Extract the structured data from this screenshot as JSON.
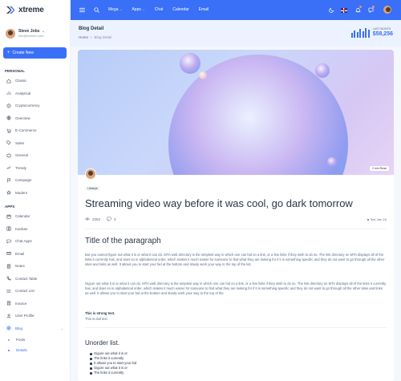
{
  "app": {
    "name": "xtreme"
  },
  "profile": {
    "name": "Steve Jobs",
    "email": "info@xtreme.com"
  },
  "sidebar": {
    "create_label": "Create New",
    "personal_title": "PERSONAL",
    "personal": [
      {
        "label": "Classic",
        "icon": "home-icon"
      },
      {
        "label": "Analytical",
        "icon": "chart-icon"
      },
      {
        "label": "Cryptocurrency",
        "icon": "coin-icon"
      },
      {
        "label": "Overview",
        "icon": "globe-icon"
      },
      {
        "label": "E-Commerce",
        "icon": "cart-icon"
      },
      {
        "label": "Sales",
        "icon": "tag-icon"
      },
      {
        "label": "General",
        "icon": "box-icon"
      },
      {
        "label": "Trendy",
        "icon": "trend-icon"
      },
      {
        "label": "Campaign",
        "icon": "flag-icon"
      },
      {
        "label": "Modern",
        "icon": "star-icon"
      }
    ],
    "apps_title": "APPS",
    "apps": [
      {
        "label": "Calendar",
        "icon": "calendar-icon"
      },
      {
        "label": "Kanban",
        "icon": "kanban-icon"
      },
      {
        "label": "Chat Apps",
        "icon": "chat-icon"
      },
      {
        "label": "Email",
        "icon": "mail-icon"
      },
      {
        "label": "Notes",
        "icon": "note-icon"
      },
      {
        "label": "Contact Table",
        "icon": "phone-icon"
      },
      {
        "label": "Contact List",
        "icon": "list-icon"
      },
      {
        "label": "Invoice",
        "icon": "invoice-icon"
      },
      {
        "label": "User Profile",
        "icon": "user-icon"
      },
      {
        "label": "Blog",
        "icon": "blog-icon"
      }
    ],
    "blog_sub": [
      "Posts",
      "Details"
    ]
  },
  "topbar": {
    "menu": [
      {
        "label": "Mega",
        "has_dropdown": true
      },
      {
        "label": "Apps",
        "has_dropdown": true
      },
      {
        "label": "Chat",
        "has_dropdown": false
      },
      {
        "label": "Calendar",
        "has_dropdown": false
      },
      {
        "label": "Email",
        "has_dropdown": false
      }
    ]
  },
  "page": {
    "title": "Blog Detail",
    "breadcrumb_home": "Home",
    "breadcrumb_current": "Blog Detail",
    "earnings_label": "LAST MONTH",
    "earnings_value": "$58,256",
    "earnings_bars": [
      0.45,
      0.7,
      0.55,
      0.9,
      0.65,
      1.0,
      0.8
    ]
  },
  "post": {
    "read_time": "2 min Read",
    "category": "Lifestyle",
    "title": "Streaming video way before it was cool, go dark tomorrow",
    "views": "2252",
    "comments": "3",
    "date": "Sat, Jan 16",
    "section_title": "Title of the paragraph",
    "para1": "But you cannot figure out what it is or what it can do. MTA web directory is the simplest way in which one can bid on a link, or a few links if they wish to do so. The link directory on MTA displays all of the links it currently has, and does so in alphabetical order, which makes it much easier for someone to find what they are looking for if it is something specific and they do not want to go through all the other sites and links as well. It allows you to start your bid at the bottom and slowly work your way to the top of the list.",
    "para2": "Gigure out what it is or what it can do. MTA web directory is the simplest way in which one can bid on a link, or a few links if they wish to do so. The link directory on MTA displays all of the links it currently has, and does so in alphabetical order, which makes it much easier for someone to find what they are looking for if it is something specific and they do not want to go through all the other sites and links as well. It allows you to start your bid at the bottom and slowly work your way to the top of the",
    "strong_text": "This is strong text.",
    "dull_text": "This is dull text.",
    "list_title": "Unorder list.",
    "list": [
      "Gigure out what it is or",
      "The links it currently",
      "It allows you to start your bid",
      "Gigure out what it is or",
      "The links it currently"
    ]
  },
  "colors": {
    "primary": "#3a6ff7",
    "page_bg": "#f4f7fb",
    "header_bg": "#ecf2ff"
  }
}
